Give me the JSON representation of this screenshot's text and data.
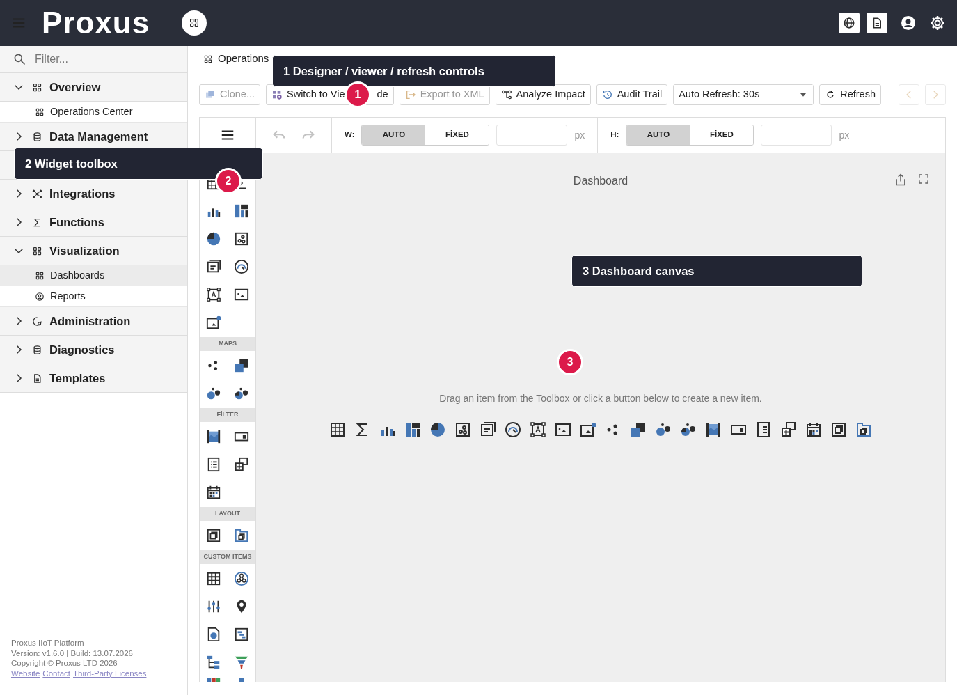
{
  "app": {
    "title": "Proxus"
  },
  "sidebar": {
    "filter": {
      "placeholder": "Filter..."
    },
    "items": [
      {
        "label": "Overview",
        "expanded": true,
        "children": [
          {
            "label": "Operations Center",
            "selected": false
          }
        ]
      },
      {
        "label": "Data Management",
        "expanded": false
      },
      {
        "label": "Integrations",
        "expanded": false
      },
      {
        "label": "Functions",
        "expanded": false
      },
      {
        "label": "Visualization",
        "expanded": true,
        "children": [
          {
            "label": "Dashboards",
            "selected": true
          },
          {
            "label": "Reports",
            "selected": false
          }
        ]
      },
      {
        "label": "Administration",
        "expanded": false
      },
      {
        "label": "Diagnostics",
        "expanded": false
      },
      {
        "label": "Templates",
        "expanded": false
      }
    ]
  },
  "footer": {
    "lines": [
      "Proxus IIoT Platform",
      "Version: v1.6.0 | Build: 13.07.2026",
      "Copyright © Proxus LTD 2026"
    ],
    "links": [
      "Website",
      "Contact",
      "Third-Party Licenses"
    ]
  },
  "tabs": [
    {
      "label": "Operations",
      "selected": true
    }
  ],
  "toolbar": {
    "buttons": [
      {
        "kind": "button",
        "label": "Clone...",
        "disabled": true
      },
      {
        "kind": "button",
        "label": "Switch to Vie",
        "label_tail": "de",
        "disabled": false
      },
      {
        "kind": "button",
        "label": "Export to XML",
        "disabled": true
      },
      {
        "kind": "button",
        "label": "Analyze Impact",
        "disabled": false
      },
      {
        "kind": "button",
        "label": "Audit Trail",
        "disabled": false
      },
      {
        "kind": "dropdown",
        "label": "Auto Refresh: 30s",
        "disabled": false
      },
      {
        "kind": "button",
        "label": "Refresh",
        "disabled": false
      }
    ],
    "nav_buttons": [
      {
        "disabled": true
      },
      {
        "disabled": true
      }
    ]
  },
  "designer": {
    "undo": {
      "disabled": true
    },
    "redo": {
      "disabled": true
    },
    "sizes": [
      {
        "label": "W:",
        "options": [
          {
            "label": "AUTO",
            "selected": true
          },
          {
            "label": "FİXED",
            "selected": false
          }
        ],
        "unit": "px"
      },
      {
        "label": "H:",
        "options": [
          {
            "label": "AUTO",
            "selected": true
          },
          {
            "label": "FİXED",
            "selected": false
          }
        ],
        "unit": "px"
      }
    ]
  },
  "toolbox": {
    "sections": [
      {
        "label": "MAPS"
      },
      {
        "label": "FİLTER"
      },
      {
        "label": "LAYOUT"
      },
      {
        "label": "CUSTOM ITEMS"
      }
    ]
  },
  "canvas": {
    "title": "Dashboard",
    "hint": "Drag an item from the Toolbox or click a button below to create a new item."
  },
  "callouts": [
    {
      "number": "1",
      "label": "1 Designer / viewer / refresh controls"
    },
    {
      "number": "2",
      "label": "2 Widget toolbox"
    },
    {
      "number": "3",
      "label": "3 Dashboard canvas"
    }
  ]
}
